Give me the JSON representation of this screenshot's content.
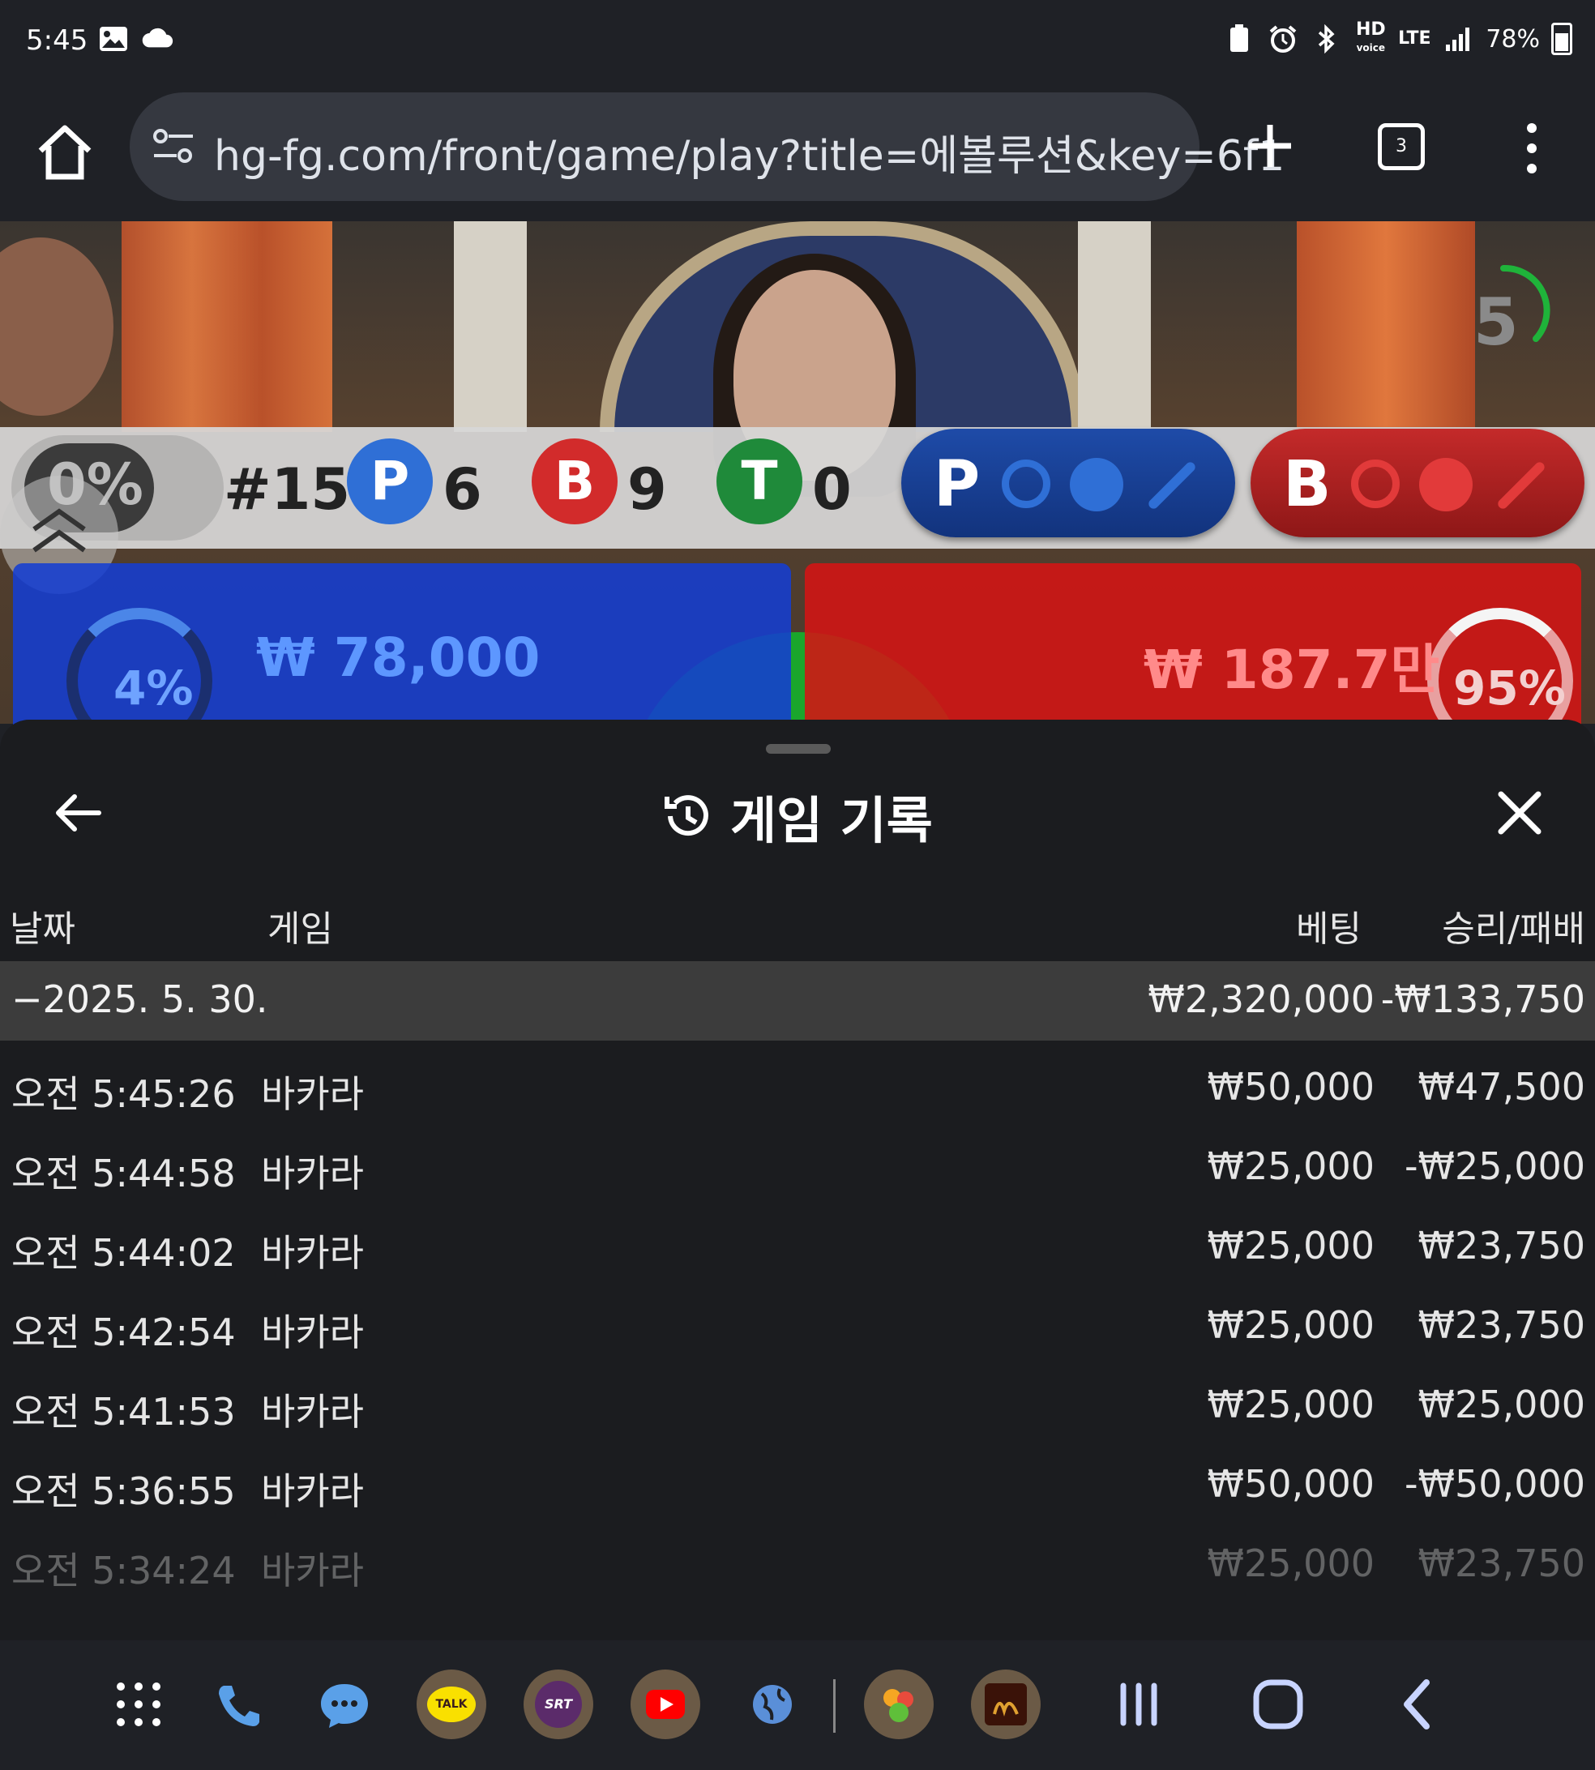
{
  "status_bar": {
    "time": "5:45",
    "battery": "78%",
    "hd_label": "HD",
    "hd_sub": "voice",
    "lte_label": "LTE"
  },
  "browser": {
    "url": "hg-fg.com/front/game/play?title=에볼루션&key=6f1",
    "tab_count": "3"
  },
  "game": {
    "timer": "5",
    "percent_badge": "0%",
    "round": "#15",
    "player_letter": "P",
    "player_count": "6",
    "banker_letter": "B",
    "banker_count": "9",
    "tie_letter": "T",
    "tie_count": "0",
    "player_predict_letter": "P",
    "banker_predict_letter": "B",
    "player_bet_pct": "4%",
    "player_bet_amount": "₩ 78,000",
    "banker_bet_pct": "95%",
    "banker_bet_amount": "₩ 187.7만",
    "colors": {
      "player": "#2f6fd6",
      "banker": "#d22b2b",
      "tie": "#1f8a3a"
    }
  },
  "history_sheet": {
    "title": "게임 기록",
    "columns": {
      "date": "날짜",
      "game": "게임",
      "bet": "베팅",
      "winloss": "승리/패배"
    },
    "date_group": {
      "date": "−2025. 5. 30.",
      "total_bet": "₩2,320,000",
      "total_winloss": "-₩133,750"
    },
    "rows": [
      {
        "time": "오전 5:45:26",
        "game": "바카라",
        "bet": "₩50,000",
        "winloss": "₩47,500"
      },
      {
        "time": "오전 5:44:58",
        "game": "바카라",
        "bet": "₩25,000",
        "winloss": "-₩25,000"
      },
      {
        "time": "오전 5:44:02",
        "game": "바카라",
        "bet": "₩25,000",
        "winloss": "₩23,750"
      },
      {
        "time": "오전 5:42:54",
        "game": "바카라",
        "bet": "₩25,000",
        "winloss": "₩23,750"
      },
      {
        "time": "오전 5:41:53",
        "game": "바카라",
        "bet": "₩25,000",
        "winloss": "₩25,000"
      },
      {
        "time": "오전 5:36:55",
        "game": "바카라",
        "bet": "₩50,000",
        "winloss": "-₩50,000"
      },
      {
        "time": "오전 5:34:24",
        "game": "바카라",
        "bet": "₩25,000",
        "winloss": "₩23,750"
      }
    ]
  },
  "dock": {
    "apps": [
      "apps-grid-icon",
      "phone-icon",
      "messages-icon",
      "kakaotalk-icon",
      "srt-icon",
      "youtube-icon",
      "browser-globe-icon",
      "game-app-icon",
      "lineage-m-icon"
    ],
    "kakaotalk_label": "TALK",
    "srt_label": "SRT"
  }
}
